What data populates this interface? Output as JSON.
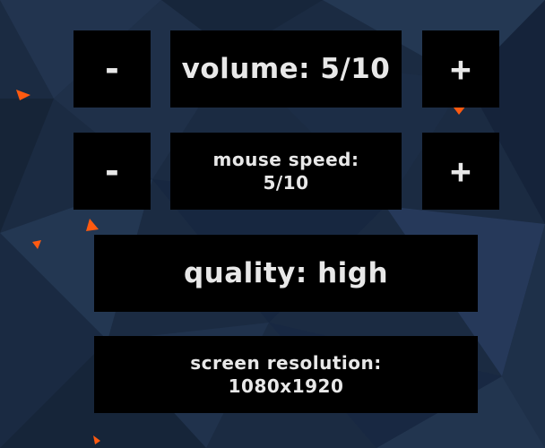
{
  "colors": {
    "background": "#1a2a40",
    "button": "#000000",
    "text": "#e8e8e8",
    "accent": "#ff5a10"
  },
  "settings": {
    "volume": {
      "decrease_label": "-",
      "label": "volume: 5/10",
      "increase_label": "+"
    },
    "mouse_speed": {
      "decrease_label": "-",
      "label": "mouse speed:\n5/10",
      "increase_label": "+"
    },
    "quality": {
      "label": "quality: high"
    },
    "screen_resolution": {
      "label": "screen resolution:\n1080x1920"
    }
  }
}
